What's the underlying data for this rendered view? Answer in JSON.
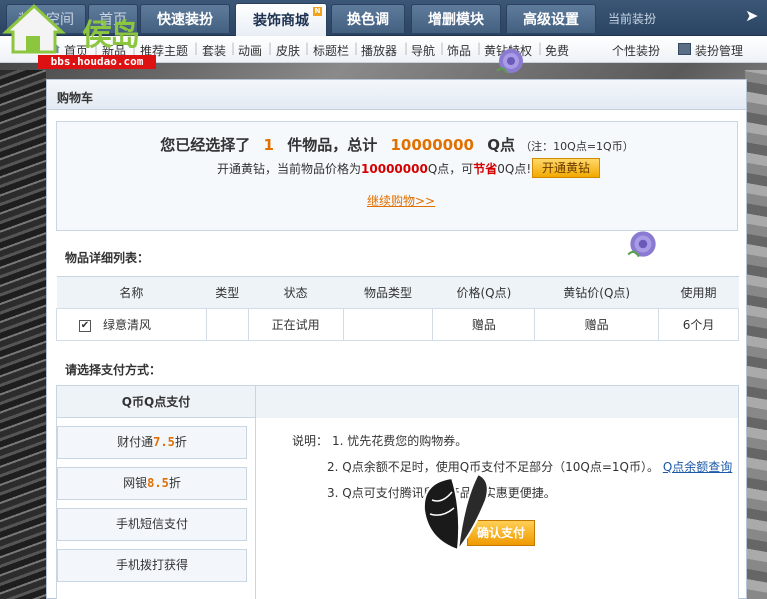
{
  "logo": {
    "text": "侯岛",
    "url": "bbs.houdao.com"
  },
  "top_tabs": [
    {
      "label": "装扮空间"
    },
    {
      "label": "首页"
    },
    {
      "label": "快速装扮"
    },
    {
      "label": "装饰商城"
    },
    {
      "label": "换色调"
    },
    {
      "label": "增删模块"
    },
    {
      "label": "高级设置"
    }
  ],
  "current_dress": "当前装扮",
  "sub_nav": [
    "首页",
    "新品",
    "推荐主题",
    "套装",
    "动画",
    "皮肤",
    "标题栏",
    "播放器",
    "导航",
    "饰品",
    "黄钻特权",
    "免费"
  ],
  "sub_nav_right": {
    "personal": "个性装扮",
    "manage": "装扮管理"
  },
  "panel": {
    "title": "购物车"
  },
  "summary": {
    "prefix": "您已经选择了",
    "count": "1",
    "mid": "件物品，总计",
    "total": "10000000",
    "unit": "Q点",
    "note": "（注：10Q点=1Q币）",
    "line2_pre": "开通黄钻，当前物品价格为",
    "line2_price": "10000000",
    "line2_mid": "Q点，可",
    "line2_save": "节省",
    "line2_save_val": "0Q点!",
    "open_vip": "开通黄钻",
    "continue": "继续购物>>"
  },
  "detail_label": "物品详细列表：",
  "table": {
    "headers": [
      "名称",
      "类型",
      "状态",
      "物品类型",
      "价格(Q点)",
      "黄钻价(Q点)",
      "使用期"
    ],
    "rows": [
      {
        "name": "绿意清风",
        "type": "",
        "status": "正在试用",
        "item_type": "",
        "price": "赠品",
        "vip_price": "赠品",
        "period": "6个月"
      }
    ]
  },
  "pay_label": "请选择支付方式：",
  "pay": {
    "head": "Q币Q点支付",
    "options": [
      {
        "label": "财付通",
        "num": "7.5",
        "suffix": "折"
      },
      {
        "label": "网银",
        "num": "8.5",
        "suffix": "折"
      },
      {
        "label": "手机短信支付",
        "num": "",
        "suffix": ""
      },
      {
        "label": "手机拨打获得",
        "num": "",
        "suffix": ""
      }
    ],
    "desc_prefix": "说明：",
    "desc1": "1. 忧先花费您的购物券。",
    "desc2": "2. Q点余额不足时，使用Q币支付不足部分（10Q点=1Q币）。",
    "desc2_link": "Q点余额查询",
    "desc3": "3. Q点可支付腾讯所有产品，实惠更便捷。",
    "confirm": "确认支付"
  }
}
